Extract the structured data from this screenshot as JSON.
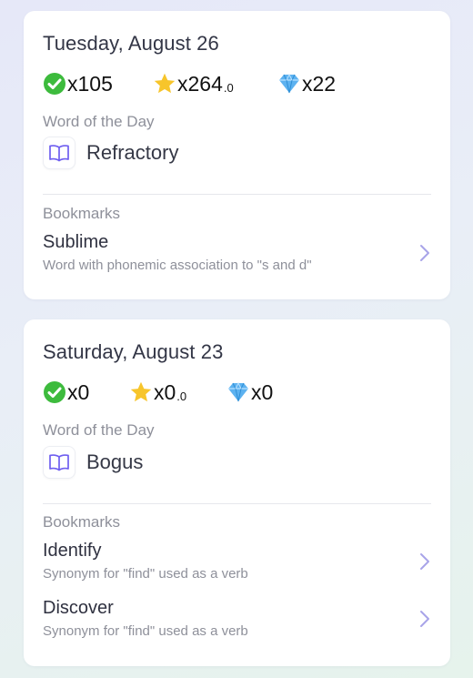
{
  "cards": [
    {
      "date": "Tuesday, August 26",
      "stats": {
        "check": {
          "value": "x105"
        },
        "star": {
          "value": "x264",
          "decimal": ".0"
        },
        "gem": {
          "value": "x22"
        }
      },
      "word_of_day_label": "Word of the Day",
      "word_of_day": "Refractory",
      "bookmarks_label": "Bookmarks",
      "bookmarks": [
        {
          "word": "Sublime",
          "description": "Word with phonemic association to \"s and d\""
        }
      ]
    },
    {
      "date": "Saturday, August 23",
      "stats": {
        "check": {
          "value": "x0"
        },
        "star": {
          "value": "x0",
          "decimal": ".0"
        },
        "gem": {
          "value": "x0"
        }
      },
      "word_of_day_label": "Word of the Day",
      "word_of_day": "Bogus",
      "bookmarks_label": "Bookmarks",
      "bookmarks": [
        {
          "word": "Identify",
          "description": "Synonym for \"find\" used as a verb"
        },
        {
          "word": "Discover",
          "description": "Synonym for \"find\" used as a verb"
        }
      ]
    }
  ],
  "icons": {
    "check": "check-circle-icon",
    "star": "star-icon",
    "gem": "diamond-gem-icon",
    "book": "open-book-icon",
    "chevron": "chevron-right-icon"
  },
  "colors": {
    "check_green": "#3dbb3d",
    "star_gold": "#f7c52b",
    "gem_blue": "#5db2f0",
    "accent_purple": "#6f5ff0",
    "chevron_lilac": "#a8a4e8"
  }
}
